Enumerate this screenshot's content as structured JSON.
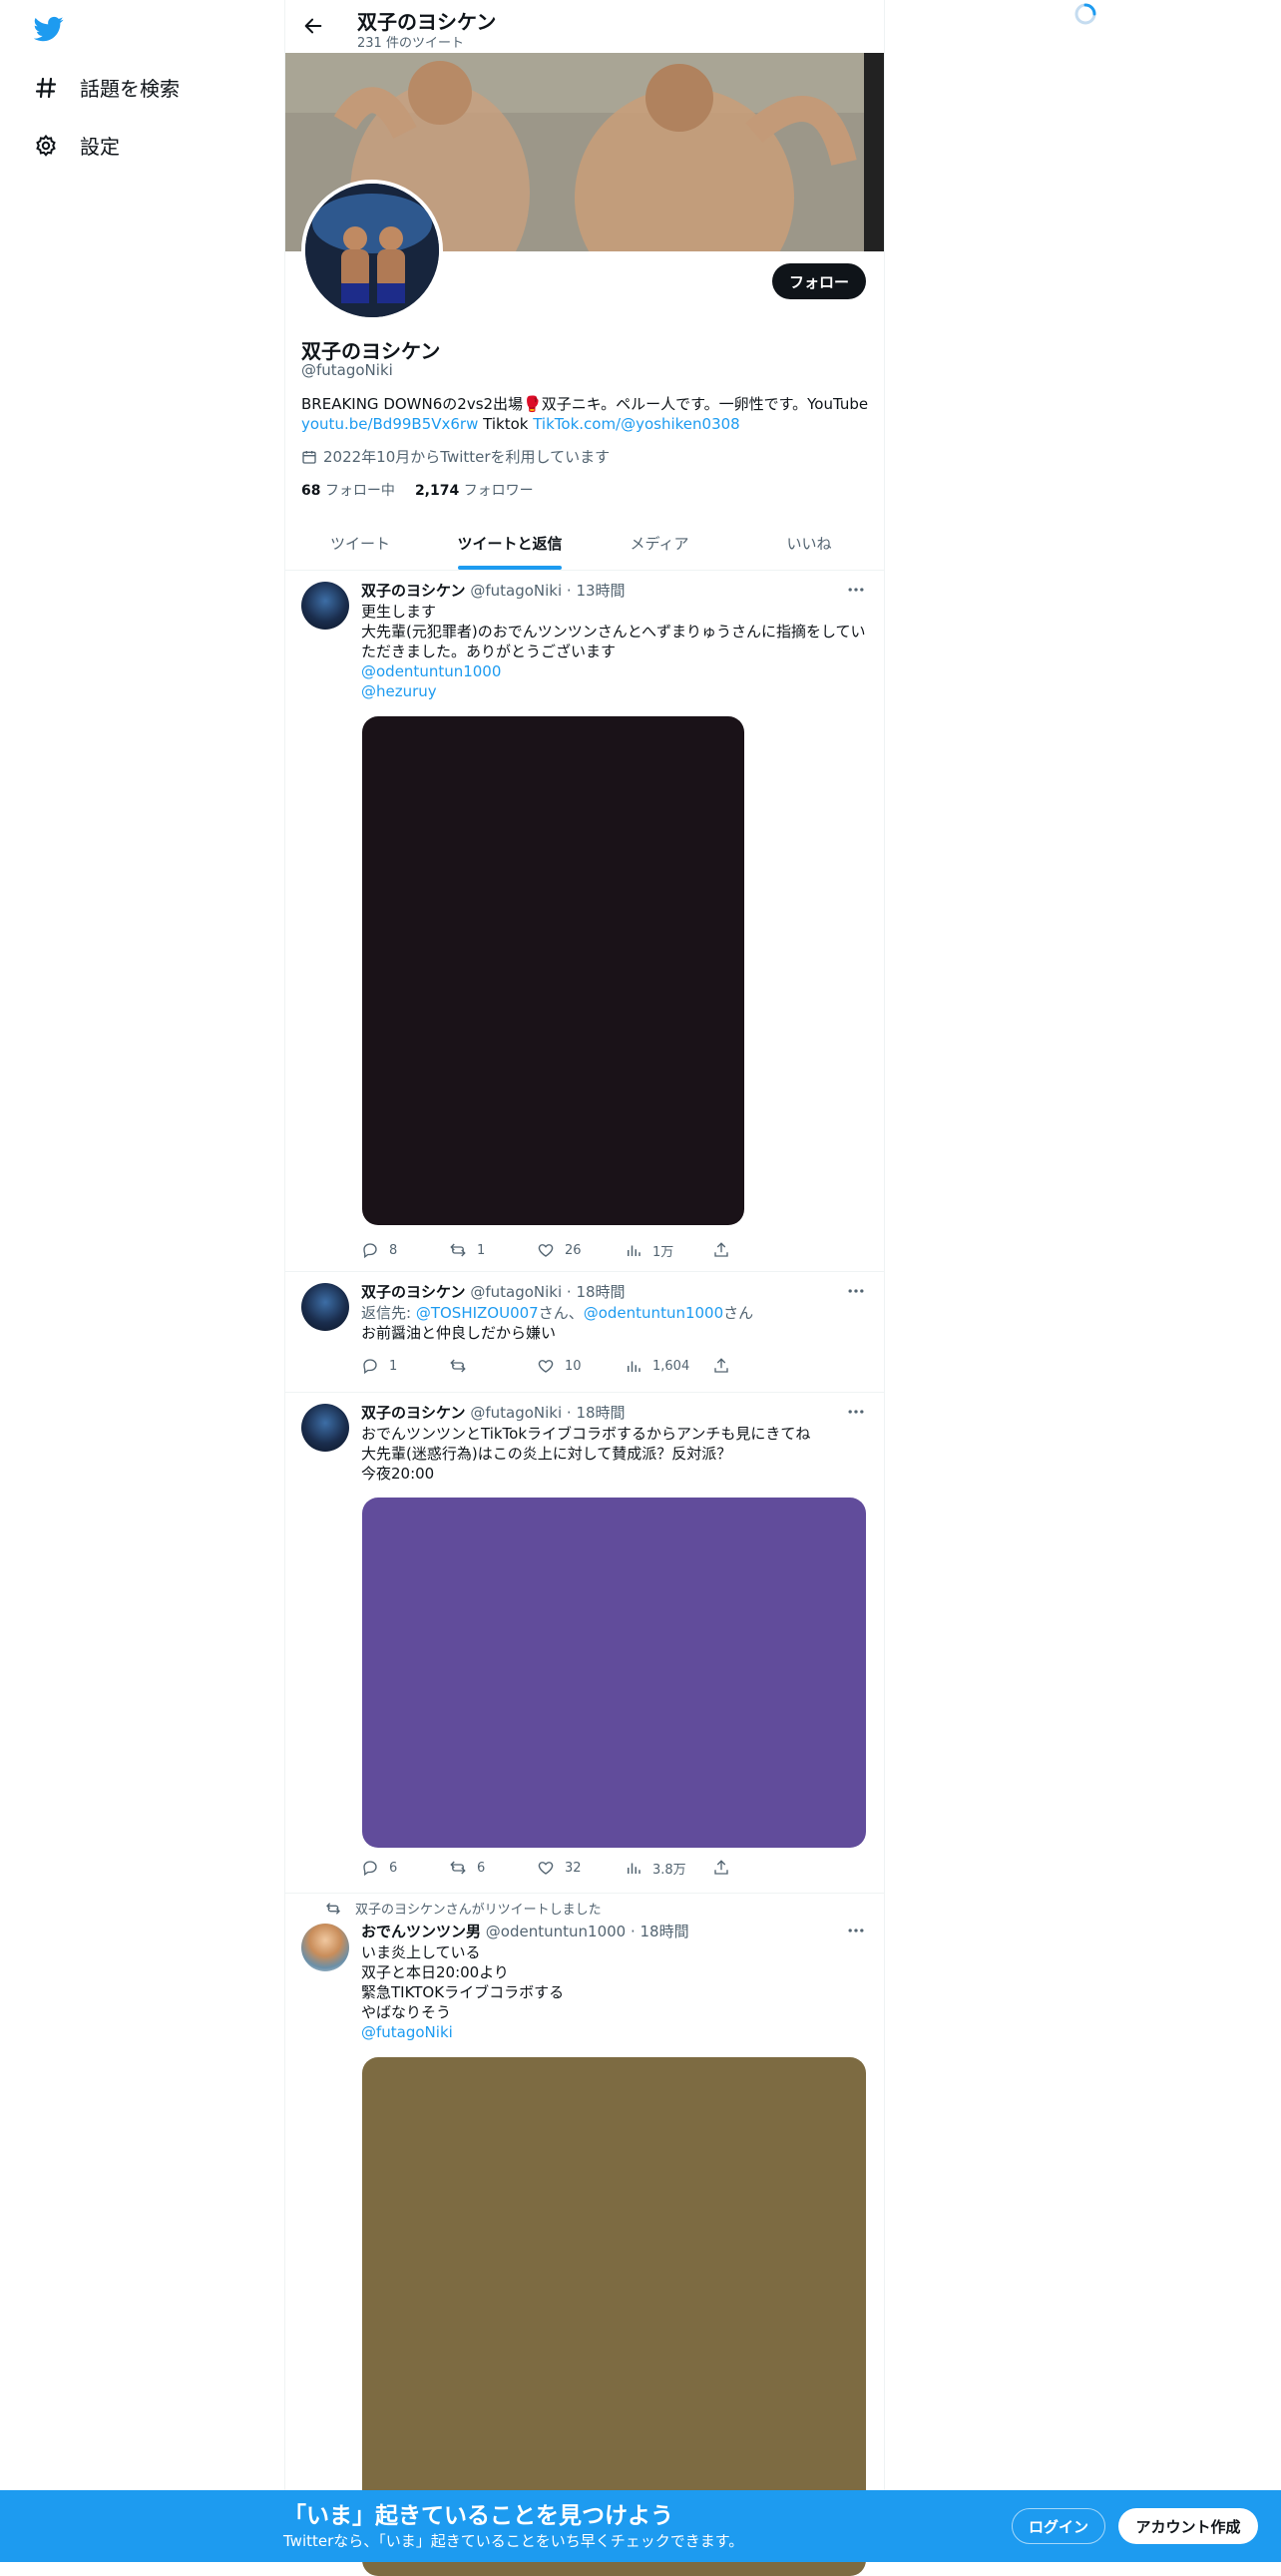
{
  "nav": {
    "explore_label": "話題を検索",
    "settings_label": "設定"
  },
  "header": {
    "title": "双子のヨシケン",
    "tweet_count": "231 件のツイート"
  },
  "profile": {
    "name": "双子のヨシケン",
    "handle": "@futagoNiki",
    "follow_label": "フォロー",
    "bio_text": "BREAKING DOWN6の2vs2出場🥊双子ニキ。ペルー人です。一卵性です。YouTube",
    "bio_link1": "youtu.be/Bd99B5Vx6rw",
    "bio_mid": " Tiktok ",
    "bio_link2": "TikTok.com/@yoshiken0308",
    "joined": "2022年10月からTwitterを利用しています",
    "following_count": "68",
    "following_label": "フォロー中",
    "followers_count": "2,174",
    "followers_label": "フォロワー"
  },
  "tabs": [
    {
      "label": "ツイート"
    },
    {
      "label": "ツイートと返信"
    },
    {
      "label": "メディア"
    },
    {
      "label": "いいね"
    }
  ],
  "tweets": [
    {
      "name": "双子のヨシケン",
      "meta": "@futagoNiki · 13時間",
      "lines": [
        "更生します",
        "大先輩(元犯罪者)のおでんツンツンさんとへずまりゅうさんに指摘をしていただきました。ありがとうございます"
      ],
      "mentions": [
        "@odentuntun1000",
        "@hezuruy"
      ],
      "media_color": "#1a1218",
      "reply": "8",
      "retweet": "1",
      "like": "26",
      "views": "1万"
    },
    {
      "name": "双子のヨシケン",
      "meta": "@futagoNiki · 18時間",
      "reply_prefix": "返信先: ",
      "reply_to1": "@TOSHIZOU007",
      "reply_sep": "さん、",
      "reply_to2": "@odentuntun1000",
      "reply_suffix": "さん",
      "lines": [
        "お前醤油と仲良しだから嫌い"
      ],
      "reply": "1",
      "retweet": "",
      "like": "10",
      "views": "1,604"
    },
    {
      "name": "双子のヨシケン",
      "meta": "@futagoNiki · 18時間",
      "lines": [
        "おでんツンツンとTikTokライブコラボするからアンチも見にきてね",
        "大先輩(迷惑行為)はこの炎上に対して賛成派？反対派？",
        "今夜20:00"
      ],
      "media_color": "#614c9b",
      "reply": "6",
      "retweet": "6",
      "like": "32",
      "views": "3.8万"
    },
    {
      "retweet_note": "双子のヨシケンさんがリツイートしました",
      "name": "おでんツンツン男",
      "meta": "@odentuntun1000 · 18時間",
      "lines": [
        "いま炎上している",
        "双子と本日20:00より",
        "緊急TIKTOKライブコラボする",
        "やばなりそう"
      ],
      "mentions": [
        "@futagoNiki"
      ],
      "media_color": "#7d6b42"
    }
  ],
  "bottom_bar": {
    "title": "「いま」起きていることを見つけよう",
    "subtitle": "Twitterなら、「いま」起きていることをいち早くチェックできます。",
    "login_label": "ログイン",
    "signup_label": "アカウント作成"
  },
  "colors": {
    "brand": "#1d9bf0",
    "text": "#0f1419",
    "secondary": "#536471"
  }
}
